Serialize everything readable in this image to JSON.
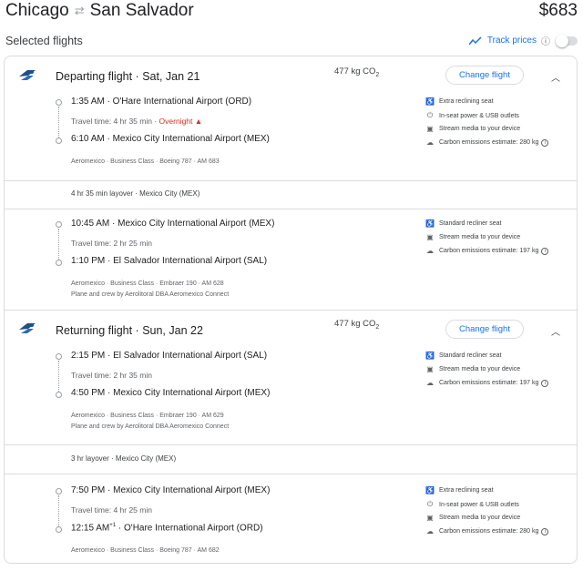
{
  "header": {
    "origin": "Chicago",
    "destination": "San Salvador",
    "price": "$683"
  },
  "selected_title": "Selected flights",
  "track_prices": {
    "label": "Track prices",
    "enabled": false
  },
  "departing": {
    "title": "Departing flight",
    "date": "Sat, Jan 21",
    "co2_value": "477 kg CO",
    "co2_sub": "2",
    "change_label": "Change flight",
    "leg1": {
      "dep": "1:35 AM",
      "dep_airport": "O'Hare International Airport (ORD)",
      "travel": "Travel time: 4 hr 35 min",
      "warning": "Overnight",
      "arr": "6:10 AM",
      "arr_airport": "Mexico City International Airport (MEX)",
      "details": "Aeromexico · Business Class · Boeing 787 · AM 683",
      "amenities": [
        "Extra reclining seat",
        "In-seat power & USB outlets",
        "Stream media to your device",
        "Carbon emissions estimate: 280 kg"
      ]
    },
    "layover": "4 hr 35 min layover · Mexico City (MEX)",
    "leg2": {
      "dep": "10:45 AM",
      "dep_airport": "Mexico City International Airport (MEX)",
      "travel": "Travel time: 2 hr 25 min",
      "arr": "1:10 PM",
      "arr_airport": "El Salvador International Airport (SAL)",
      "details": "Aeromexico · Business Class · Embraer 190 · AM 628",
      "operator": "Plane and crew by Aerolitoral DBA Aeromexico Connect",
      "amenities": [
        "Standard recliner seat",
        "Stream media to your device",
        "Carbon emissions estimate: 197 kg"
      ]
    }
  },
  "returning": {
    "title": "Returning flight",
    "date": "Sun, Jan 22",
    "co2_value": "477 kg CO",
    "co2_sub": "2",
    "change_label": "Change flight",
    "leg1": {
      "dep": "2:15 PM",
      "dep_airport": "El Salvador International Airport (SAL)",
      "travel": "Travel time: 2 hr 35 min",
      "arr": "4:50 PM",
      "arr_airport": "Mexico City International Airport (MEX)",
      "details": "Aeromexico · Business Class · Embraer 190 · AM 629",
      "operator": "Plane and crew by Aerolitoral DBA Aeromexico Connect",
      "amenities": [
        "Standard recliner seat",
        "Stream media to your device",
        "Carbon emissions estimate: 197 kg"
      ]
    },
    "layover": "3 hr layover · Mexico City (MEX)",
    "leg2": {
      "dep": "7:50 PM",
      "dep_airport": "Mexico City International Airport (MEX)",
      "travel": "Travel time: 4 hr 25 min",
      "arr": "12:15 AM",
      "arr_sup": "+1",
      "arr_airport": "O'Hare International Airport (ORD)",
      "details": "Aeromexico · Business Class · Boeing 787 · AM 682",
      "amenities": [
        "Extra reclining seat",
        "In-seat power & USB outlets",
        "Stream media to your device",
        "Carbon emissions estimate: 280 kg"
      ]
    }
  },
  "colors": {
    "accent": "#1a73e8",
    "warning": "#d93025",
    "border": "#dadce0",
    "muted": "#5f6368"
  },
  "icons": [
    "swap-arrows-icon",
    "trend-line-icon",
    "info-icon",
    "airline-logo-icon",
    "chevron-up-icon",
    "warning-icon",
    "seat-icon",
    "power-plug-icon",
    "media-icon",
    "co2-icon"
  ]
}
